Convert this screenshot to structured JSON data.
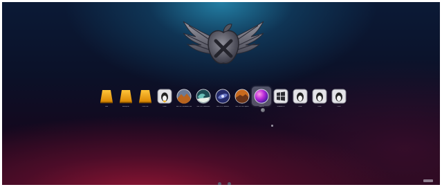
{
  "boot_menu": {
    "items": [
      {
        "label": "Data",
        "icon": "hard-drive-icon"
      },
      {
        "label": "Backup HD",
        "icon": "hard-drive-icon"
      },
      {
        "label": "Data Disk",
        "icon": "hard-drive-icon"
      },
      {
        "label": "Linux",
        "icon": "linux-icon"
      },
      {
        "label": "Mac OS X Mountain Lion",
        "icon": "mountain-icon"
      },
      {
        "label": "Mac OS X Mavericks",
        "icon": "wave-icon"
      },
      {
        "label": "Mac OS X Yosemite",
        "icon": "galaxy-icon"
      },
      {
        "label": "Mac OS X El Capitan",
        "icon": "mountain-icon"
      },
      {
        "label": "macOS",
        "icon": "macos-icon"
      },
      {
        "label": "Windows 10",
        "icon": "windows-icon"
      },
      {
        "label": "Linux",
        "icon": "linux-icon"
      },
      {
        "label": "Linux",
        "icon": "linux-icon"
      },
      {
        "label": "Linux",
        "icon": "linux-icon"
      }
    ],
    "selected_index": 8
  },
  "page_indicator": {
    "pages": 2,
    "current": 1
  },
  "colors": {
    "accent_teal": "#2484aa",
    "accent_crimson": "#96163a",
    "background": "#0b1128"
  }
}
